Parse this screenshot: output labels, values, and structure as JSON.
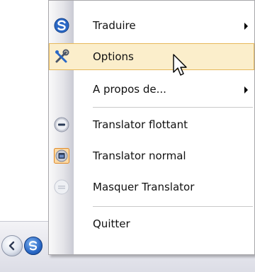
{
  "menu": {
    "items": [
      {
        "label": "Traduire",
        "icon": "translate-globe-icon",
        "submenu": true
      },
      {
        "label": "Options",
        "icon": "tools-icon",
        "highlighted": true
      },
      {
        "label": "A propos de...",
        "icon": null,
        "submenu": true
      },
      {
        "label": "Translator flottant",
        "icon": "floating-mode-icon"
      },
      {
        "label": "Translator normal",
        "icon": "normal-mode-icon",
        "selected": true
      },
      {
        "label": "Masquer Translator",
        "icon": "hide-mode-icon"
      },
      {
        "label": "Quitter",
        "icon": null
      }
    ]
  },
  "colors": {
    "highlight_bg": "#fbeecb",
    "highlight_border": "#e7b95b",
    "app_blue": "#2a68c6"
  }
}
